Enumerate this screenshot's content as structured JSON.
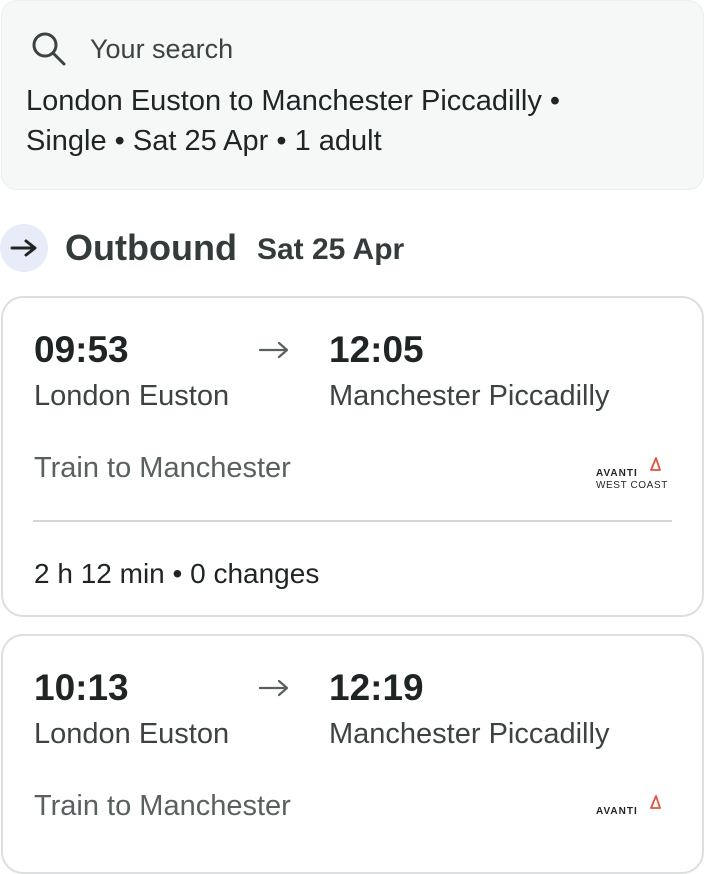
{
  "search": {
    "label": "Your search",
    "summary_line1": "London Euston to Manchester Piccadilly •",
    "summary_line2": "Single • Sat 25 Apr • 1 adult",
    "icon": "search-icon"
  },
  "outbound": {
    "title": "Outbound",
    "date": "Sat 25 Apr",
    "icon": "arrow-right-icon"
  },
  "journeys": [
    {
      "depart_time": "09:53",
      "arrive_time": "12:05",
      "origin": "London Euston",
      "destination": "Manchester Piccadilly",
      "service": "Train to Manchester",
      "duration_changes": "2 h 12 min • 0 changes",
      "operator_logo_text_1": "AVANTI",
      "operator_logo_text_2": "WEST COAST"
    },
    {
      "depart_time": "10:13",
      "arrive_time": "12:19",
      "origin": "London Euston",
      "destination": "Manchester Piccadilly",
      "service": "Train to Manchester",
      "operator_logo_text_1": "AVANTI"
    }
  ],
  "colors": {
    "card_background": "#f6f7f7",
    "badge_background": "#e8ecf9",
    "operator_accent": "#e0533a",
    "text_primary": "#1f2424",
    "text_secondary": "#5a6060"
  }
}
